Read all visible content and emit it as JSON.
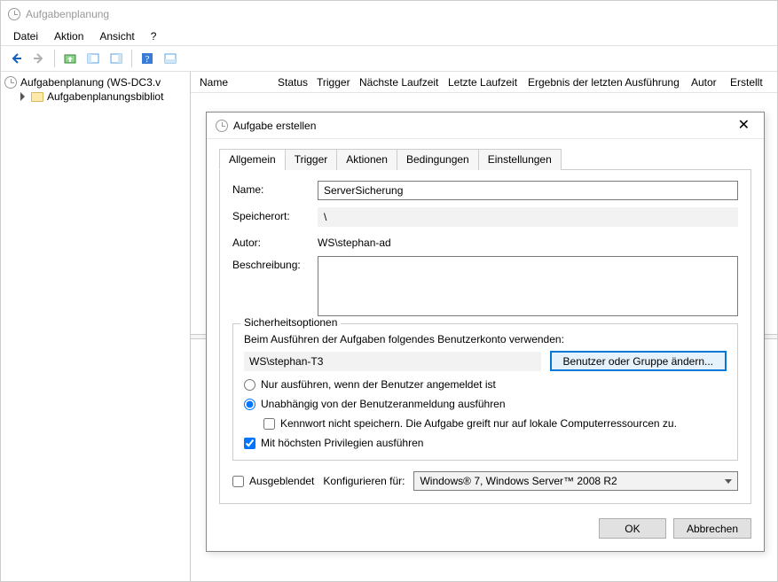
{
  "window": {
    "title": "Aufgabenplanung"
  },
  "menu": {
    "file": "Datei",
    "action": "Aktion",
    "view": "Ansicht",
    "help": "?"
  },
  "tree": {
    "root": "Aufgabenplanung (WS-DC3.v",
    "library": "Aufgabenplanungsbibliot"
  },
  "columns": {
    "name": "Name",
    "status": "Status",
    "trigger": "Trigger",
    "next": "Nächste Laufzeit",
    "last": "Letzte Laufzeit",
    "result": "Ergebnis der letzten Ausführung",
    "author": "Autor",
    "created": "Erstellt"
  },
  "dialog": {
    "title": "Aufgabe erstellen",
    "tabs": {
      "general": "Allgemein",
      "trigger": "Trigger",
      "actions": "Aktionen",
      "conditions": "Bedingungen",
      "settings": "Einstellungen"
    },
    "labels": {
      "name": "Name:",
      "location": "Speicherort:",
      "author": "Autor:",
      "description": "Beschreibung:"
    },
    "values": {
      "name": "ServerSicherung",
      "location": "\\",
      "author": "WS\\stephan-ad",
      "description": ""
    },
    "security": {
      "title": "Sicherheitsoptionen",
      "account_label": "Beim Ausführen der Aufgaben folgendes Benutzerkonto verwenden:",
      "account": "WS\\stephan-T3",
      "change_button": "Benutzer oder Gruppe ändern...",
      "run_logged_on": "Nur ausführen, wenn der Benutzer angemeldet ist",
      "run_always": "Unabhängig von der Benutzeranmeldung ausführen",
      "no_password": "Kennwort nicht speichern. Die Aufgabe greift nur auf lokale Computerressourcen zu.",
      "highest_priv": "Mit höchsten Privilegien ausführen"
    },
    "bottom": {
      "hidden": "Ausgeblendet",
      "configure_for": "Konfigurieren für:",
      "configure_value": "Windows® 7, Windows Server™ 2008 R2"
    },
    "footer": {
      "ok": "OK",
      "cancel": "Abbrechen"
    }
  }
}
